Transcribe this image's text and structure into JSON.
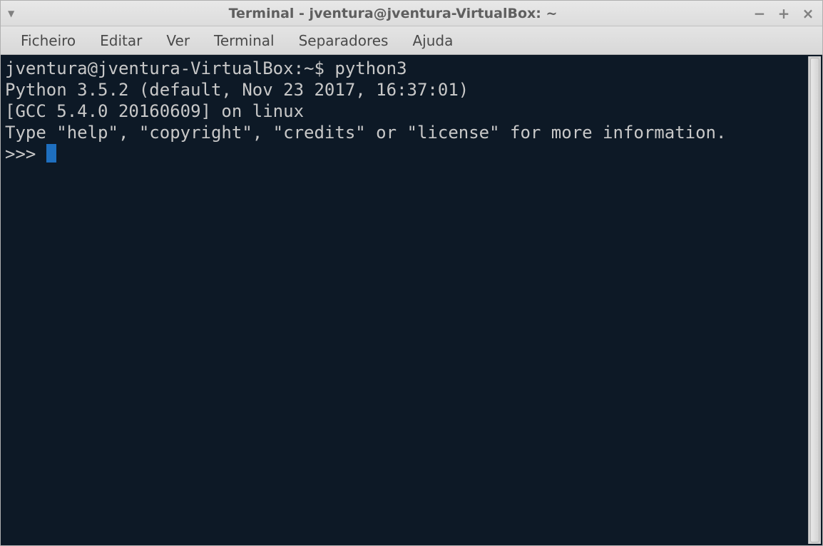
{
  "window": {
    "title": "Terminal - jventura@jventura-VirtualBox: ~"
  },
  "menubar": {
    "items": [
      {
        "label": "Ficheiro"
      },
      {
        "label": "Editar"
      },
      {
        "label": "Ver"
      },
      {
        "label": "Terminal"
      },
      {
        "label": "Separadores"
      },
      {
        "label": "Ajuda"
      }
    ]
  },
  "terminal": {
    "prompt": "jventura@jventura-VirtualBox:~$ ",
    "command": "python3",
    "output_line1": "Python 3.5.2 (default, Nov 23 2017, 16:37:01) ",
    "output_line2": "[GCC 5.4.0 20160609] on linux",
    "output_line3": "Type \"help\", \"copyright\", \"credits\" or \"license\" for more information.",
    "repl_prompt": ">>> "
  }
}
